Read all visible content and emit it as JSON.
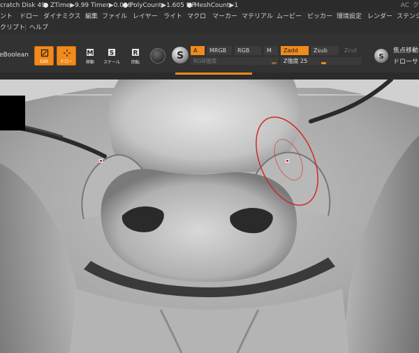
{
  "status_bar": {
    "scratch_disk": "cratch Disk 49",
    "ztime": "ZTime▶9.99 Timer▶0.016",
    "polycount": "PolyCount▶1.605 MP",
    "meshcount": "MeshCount▶1",
    "right_label": "AC",
    "right_glyph": "ク"
  },
  "menu_row1": [
    "ント",
    "ドロー",
    "ダイナミクス",
    "編集",
    "ファイル",
    "レイヤー",
    "ライト",
    "マクロ",
    "マーカー",
    "マテリアル",
    "ムービー",
    "ピッカー",
    "環境設定",
    "レンダー",
    "ステンシ"
  ],
  "menu_row2": [
    "クリプト",
    "ヘルプ"
  ],
  "toolbar": {
    "boolean_label": "eBoolean",
    "edit_label": "Edit",
    "draw_label": "ドロー",
    "move_label": "移動",
    "scale_label": "スケール",
    "rotate_label": "回転",
    "a_label": "A",
    "mrgb_label": "MRGB",
    "rgb_label": "RGB",
    "m_label": "M",
    "zadd_label": "Zadd",
    "zsub_label": "Zsub",
    "zcut_label": "Zcut",
    "rgb_intensity_label": "RGB強度",
    "z_intensity_label": "Z強度 25",
    "z_intensity_value": 25,
    "focal_shift_label": "焦点移動",
    "draw_size_label": "ドローサ",
    "accent_color": "#f08a1c"
  },
  "icons": [
    "edit-icon",
    "draw-icon",
    "move-icon",
    "scale-icon",
    "rotate-icon",
    "material-sphere-icon",
    "s-sphere-icon",
    "focal-sphere-icon"
  ],
  "viewport": {
    "description_colors": {
      "background": "#8a8a8a",
      "brush_ring": "#d32626"
    }
  }
}
